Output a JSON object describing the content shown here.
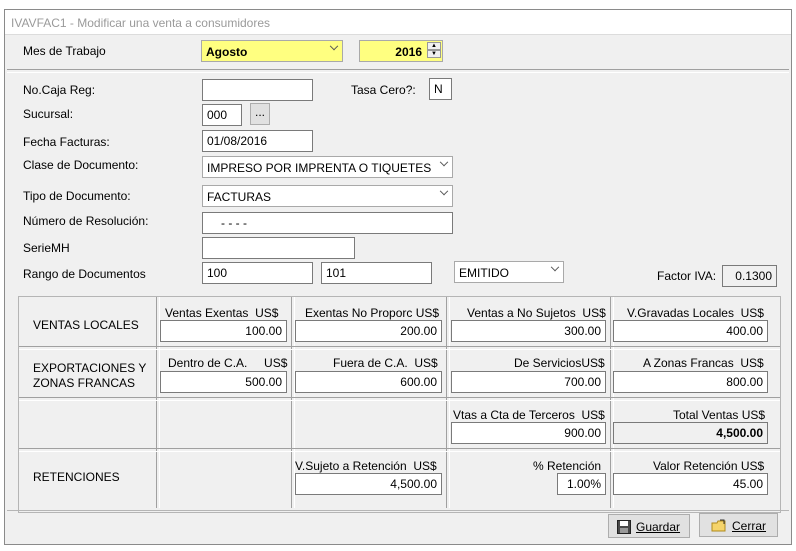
{
  "window": {
    "title": "IVAVFAC1 - Modificar una venta a consumidores"
  },
  "header": {
    "mes_label": "Mes de Trabajo",
    "mes_value": "Agosto",
    "year_value": "2016"
  },
  "form": {
    "caja_label": "No.Caja Reg:",
    "caja_value": "",
    "tasa_label": "Tasa Cero?:",
    "tasa_value": "N",
    "sucursal_label": "Sucursal:",
    "sucursal_value": "000",
    "sucursal_btn": "...",
    "fecha_label": "Fecha Facturas:",
    "fecha_value": "01/08/2016",
    "clase_label": "Clase de Documento:",
    "clase_value": "IMPRESO POR IMPRENTA O TIQUETES",
    "tipo_label": "Tipo de Documento:",
    "tipo_value": "FACTURAS",
    "resolucion_label": "Número de Resolución:",
    "resolucion_value": "-   -   -   -",
    "serie_label": "SerieMH",
    "serie_value": "",
    "rango_label": "Rango de Documentos",
    "rango_desde": "100",
    "rango_hasta": "101",
    "estado_value": "EMITIDO",
    "factor_label": "Factor IVA:",
    "factor_value": "0.1300"
  },
  "grid": {
    "row_labels": {
      "ventas_locales": "VENTAS LOCALES",
      "exportaciones_1": "EXPORTACIONES Y",
      "exportaciones_2": "ZONAS FRANCAS",
      "retenciones": "RETENCIONES"
    },
    "fields": {
      "ventas_exentas": {
        "label": "Ventas Exentas",
        "unit": "US$",
        "value": "100.00"
      },
      "exentas_no_proporc": {
        "label": "Exentas No Proporc",
        "unit": "US$",
        "value": "200.00"
      },
      "ventas_no_sujetos": {
        "label": "Ventas a No Sujetos",
        "unit": "US$",
        "value": "300.00"
      },
      "v_gravadas_locales": {
        "label": "V.Gravadas Locales",
        "unit": "US$",
        "value": "400.00"
      },
      "dentro_ca": {
        "label": "Dentro de C.A.",
        "unit": "US$",
        "value": "500.00"
      },
      "fuera_ca": {
        "label": "Fuera de C.A.",
        "unit": "US$",
        "value": "600.00"
      },
      "de_servicios": {
        "label": "De Servicios",
        "unit": "US$",
        "value": "700.00"
      },
      "zonas_francas": {
        "label": "A Zonas Francas",
        "unit": "US$",
        "value": "800.00"
      },
      "vtas_terceros": {
        "label": "Vtas a Cta de Terceros",
        "unit": "US$",
        "value": "900.00"
      },
      "total_ventas": {
        "label": "Total Ventas",
        "unit": "US$",
        "value": "4,500.00"
      },
      "v_sujeto_retencion": {
        "label": "V.Sujeto a Retención",
        "unit": "US$",
        "value": "4,500.00"
      },
      "pct_retencion": {
        "label": "% Retención",
        "value": "1.00%"
      },
      "valor_retencion": {
        "label": "Valor Retención",
        "unit": "US$",
        "value": "45.00"
      }
    }
  },
  "buttons": {
    "guardar": "Guardar",
    "cerrar": "Cerrar"
  }
}
